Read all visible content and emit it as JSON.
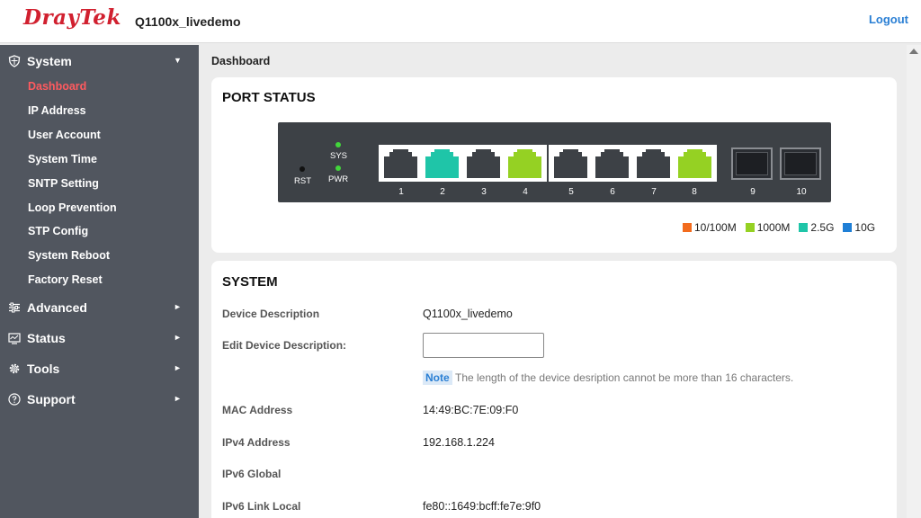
{
  "header": {
    "logo_text": "DrayTek",
    "device_name": "Q1100x_livedemo",
    "logout_label": "Logout"
  },
  "sidebar": {
    "system": {
      "label": "System",
      "icon": "shield-icon",
      "expanded": true,
      "items": [
        {
          "label": "Dashboard",
          "active": true
        },
        {
          "label": "IP Address"
        },
        {
          "label": "User Account"
        },
        {
          "label": "System Time"
        },
        {
          "label": "SNTP Setting"
        },
        {
          "label": "Loop Prevention"
        },
        {
          "label": "STP Config"
        },
        {
          "label": "System Reboot"
        },
        {
          "label": "Factory Reset"
        }
      ]
    },
    "advanced": {
      "label": "Advanced",
      "icon": "sliders-icon"
    },
    "status": {
      "label": "Status",
      "icon": "monitor-icon"
    },
    "tools": {
      "label": "Tools",
      "icon": "gear-icon"
    },
    "support": {
      "label": "Support",
      "icon": "help-icon"
    }
  },
  "breadcrumb": "Dashboard",
  "port_status": {
    "title": "PORT STATUS",
    "labels": {
      "rst": "RST",
      "sys": "SYS",
      "pwr": "PWR"
    },
    "ports": [
      {
        "num": "1",
        "status": "off"
      },
      {
        "num": "2",
        "status": "2.5G"
      },
      {
        "num": "3",
        "status": "off"
      },
      {
        "num": "4",
        "status": "1000M"
      },
      {
        "num": "5",
        "status": "off"
      },
      {
        "num": "6",
        "status": "off"
      },
      {
        "num": "7",
        "status": "off"
      },
      {
        "num": "8",
        "status": "1000M"
      },
      {
        "num": "9",
        "status": "sfp-empty"
      },
      {
        "num": "10",
        "status": "sfp-empty"
      }
    ],
    "legend": [
      {
        "label": "10/100M",
        "color": "#f26b1d"
      },
      {
        "label": "1000M",
        "color": "#95d123"
      },
      {
        "label": "2.5G",
        "color": "#1fc5a8"
      },
      {
        "label": "10G",
        "color": "#1f7fd6"
      }
    ],
    "colors": {
      "off": "#3d4146",
      "led_on": "#42d63b",
      "led_off": "#111111"
    }
  },
  "system": {
    "title": "SYSTEM",
    "device_description_label": "Device Description",
    "device_description_value": "Q1100x_livedemo",
    "edit_description_label": "Edit Device Description:",
    "edit_description_value": "",
    "note_badge": "Note",
    "note_text": "The length of the device desription cannot be more than 16 characters.",
    "mac_label": "MAC Address",
    "mac_value": "14:49:BC:7E:09:F0",
    "ipv4_label": "IPv4 Address",
    "ipv4_value": "192.168.1.224",
    "ipv6_global_label": "IPv6 Global",
    "ipv6_global_value": "",
    "ipv6_link_local_label": "IPv6 Link Local",
    "ipv6_link_local_value": "fe80::1649:bcff:fe7e:9f0"
  }
}
